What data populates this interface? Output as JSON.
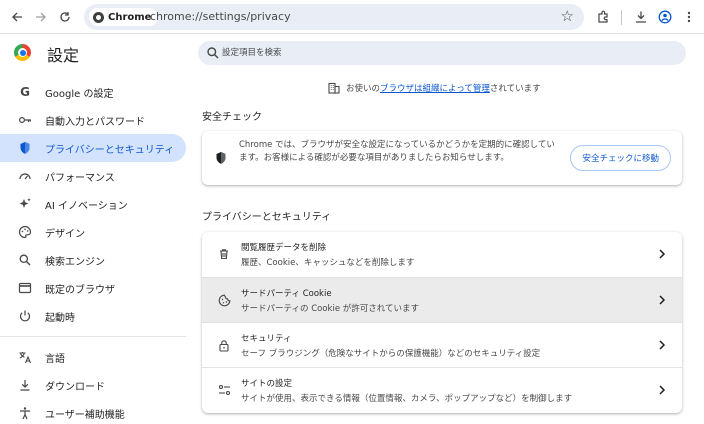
{
  "toolbar": {
    "chip_label": "Chrome",
    "url": "chrome://settings/privacy"
  },
  "header": {
    "title": "設定",
    "search_placeholder": "設定項目を検索"
  },
  "sidebar": {
    "items": [
      {
        "label": "Google の設定",
        "icon": "google-icon"
      },
      {
        "label": "自動入力とパスワード",
        "icon": "key-icon"
      },
      {
        "label": "プライバシーとセキュリティ",
        "icon": "shield-icon"
      },
      {
        "label": "パフォーマンス",
        "icon": "speedometer-icon"
      },
      {
        "label": "AI イノベーション",
        "icon": "sparkle-icon"
      },
      {
        "label": "デザイン",
        "icon": "palette-icon"
      },
      {
        "label": "検索エンジン",
        "icon": "search-icon"
      },
      {
        "label": "既定のブラウザ",
        "icon": "browser-window-icon"
      },
      {
        "label": "起動時",
        "icon": "power-icon"
      },
      {
        "label": "言語",
        "icon": "translate-icon"
      },
      {
        "label": "ダウンロード",
        "icon": "download-icon"
      },
      {
        "label": "ユーザー補助機能",
        "icon": "accessibility-icon"
      }
    ]
  },
  "managed_notice": {
    "prefix": "お使いの",
    "link1": "ブラウザは組織によって管理",
    "suffix": "されています"
  },
  "safety_check": {
    "section_title": "安全チェック",
    "description": "Chrome では、ブラウザが安全な設定になっているかどうかを定期的に確認しています。お客様による確認が必要な項目がありましたらお知らせします。",
    "button_label": "安全チェックに移動"
  },
  "privacy": {
    "section_title": "プライバシーとセキュリティ",
    "rows": [
      {
        "title": "閲覧履歴データを削除",
        "subtitle": "履歴、Cookie、キャッシュなどを削除します",
        "icon": "trash-icon"
      },
      {
        "title": "サードパーティ Cookie",
        "subtitle": "サードパーティの Cookie が許可されています",
        "icon": "cookie-icon"
      },
      {
        "title": "セキュリティ",
        "subtitle": "セーフ ブラウジング（危険なサイトからの保護機能）などのセキュリティ設定",
        "icon": "lock-icon"
      },
      {
        "title": "サイトの設定",
        "subtitle": "サイトが使用、表示できる情報（位置情報、カメラ、ポップアップなど）を制御します",
        "icon": "tune-icon"
      }
    ]
  },
  "colors": {
    "accent": "#0b57d0",
    "active_bg": "#d3e3fd",
    "search_bg": "#e9eef6"
  }
}
